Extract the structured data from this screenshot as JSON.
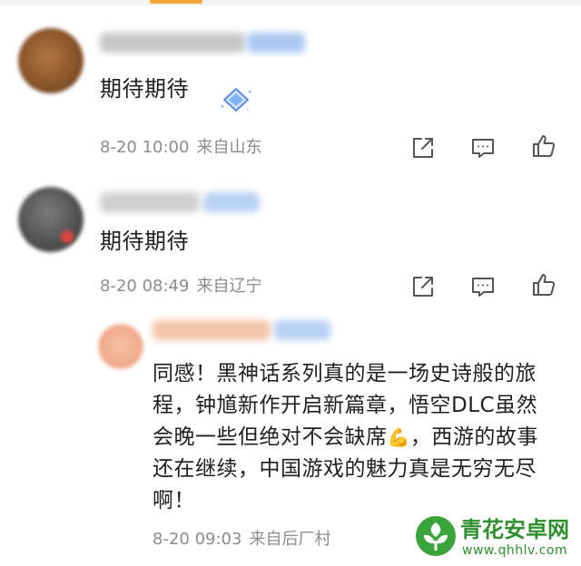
{
  "comments": [
    {
      "text": "期待期待",
      "sticker": "diamond-sticker",
      "date": "8-20 10:00",
      "location": "来自山东",
      "actions": [
        "share-icon",
        "comment-icon",
        "like-icon"
      ]
    },
    {
      "text": "期待期待",
      "date": "8-20 08:49",
      "location": "来自辽宁",
      "actions": [
        "share-icon",
        "comment-icon",
        "like-icon"
      ]
    }
  ],
  "reply": {
    "text_before_emoji": "同感！黑神话系列真的是一场史诗般的旅程，钟馗新作开启新篇章，悟空DLC虽然会晚一些但绝对不会缺席",
    "emoji": "💪",
    "text_after_emoji": "，西游的故事还在继续，中国游戏的魅力真是无穷无尽啊！",
    "date": "8-20 09:03",
    "location": "来自后厂村"
  },
  "watermark": {
    "name": "青花安卓网",
    "url": "www.qhhlv.com"
  },
  "colors": {
    "text": "#1f1f1f",
    "meta": "#8c8c8c",
    "accent": "#f4a23a",
    "watermark": "#2f8f2f"
  }
}
